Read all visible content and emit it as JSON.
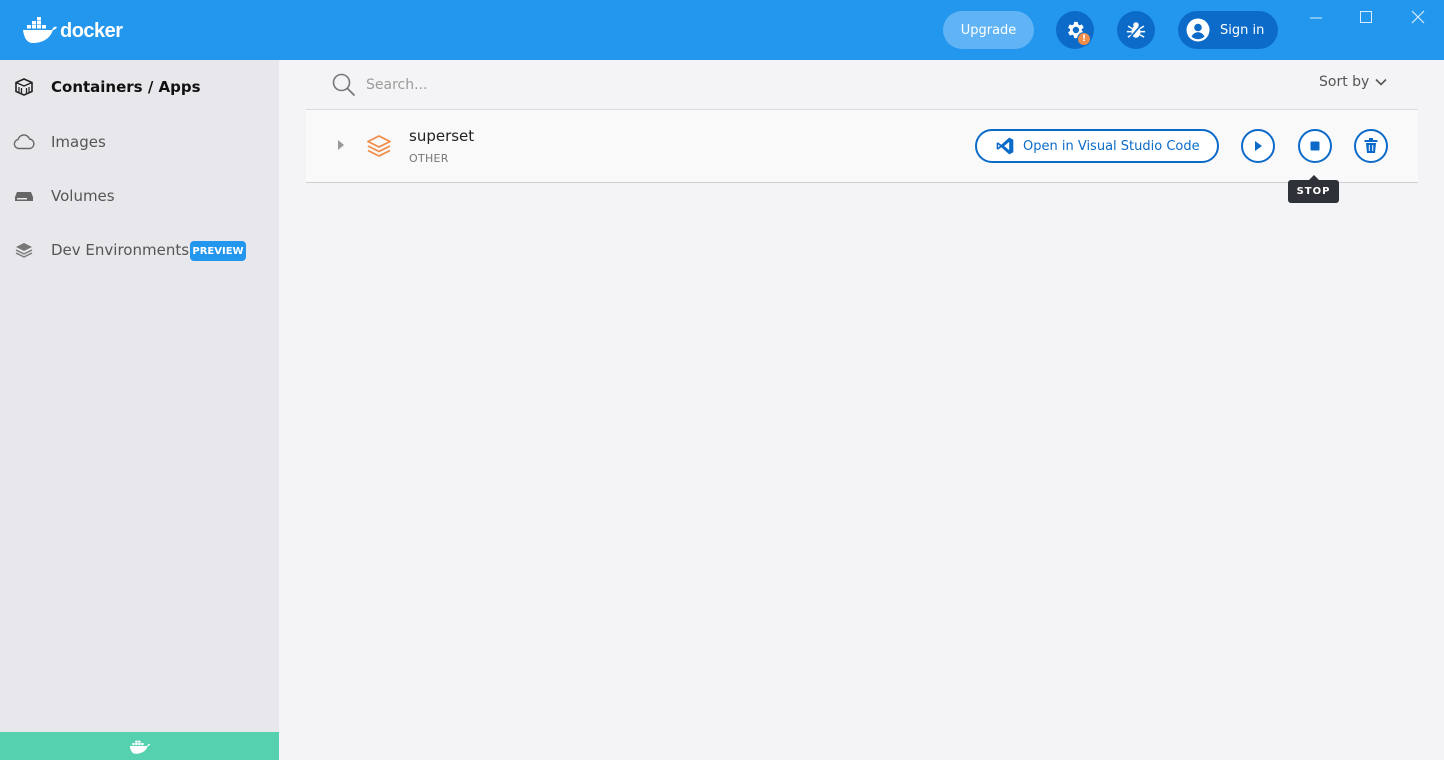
{
  "app": {
    "logo_text": "docker",
    "brand_color": "#2396ed",
    "accent_color": "#0c6bc8"
  },
  "header": {
    "upgrade_label": "Upgrade",
    "settings_icon": "gear-icon",
    "settings_badge": "!",
    "troubleshoot_icon": "bug-icon",
    "signin_label": "Sign in",
    "window_controls": [
      "minimize-icon",
      "maximize-icon",
      "close-icon"
    ]
  },
  "sidebar": {
    "items": [
      {
        "label": "Containers / Apps",
        "icon": "container-icon",
        "active": true
      },
      {
        "label": "Images",
        "icon": "cloud-icon",
        "active": false
      },
      {
        "label": "Volumes",
        "icon": "volume-icon",
        "active": false
      },
      {
        "label": "Dev Environments",
        "icon": "dev-environments-icon",
        "active": false,
        "badge": "PREVIEW"
      }
    ],
    "footer_color": "#55d1b0",
    "footer_icon": "whale-icon"
  },
  "main": {
    "search": {
      "placeholder": "Search...",
      "value": ""
    },
    "sort_label": "Sort by",
    "apps": [
      {
        "name": "superset",
        "type": "OTHER",
        "icon": "stack-icon",
        "icon_color": "#f08d49",
        "vscode_label": "Open in Visual Studio Code",
        "actions": [
          "start",
          "stop",
          "delete"
        ]
      }
    ],
    "tooltip": "STOP"
  }
}
